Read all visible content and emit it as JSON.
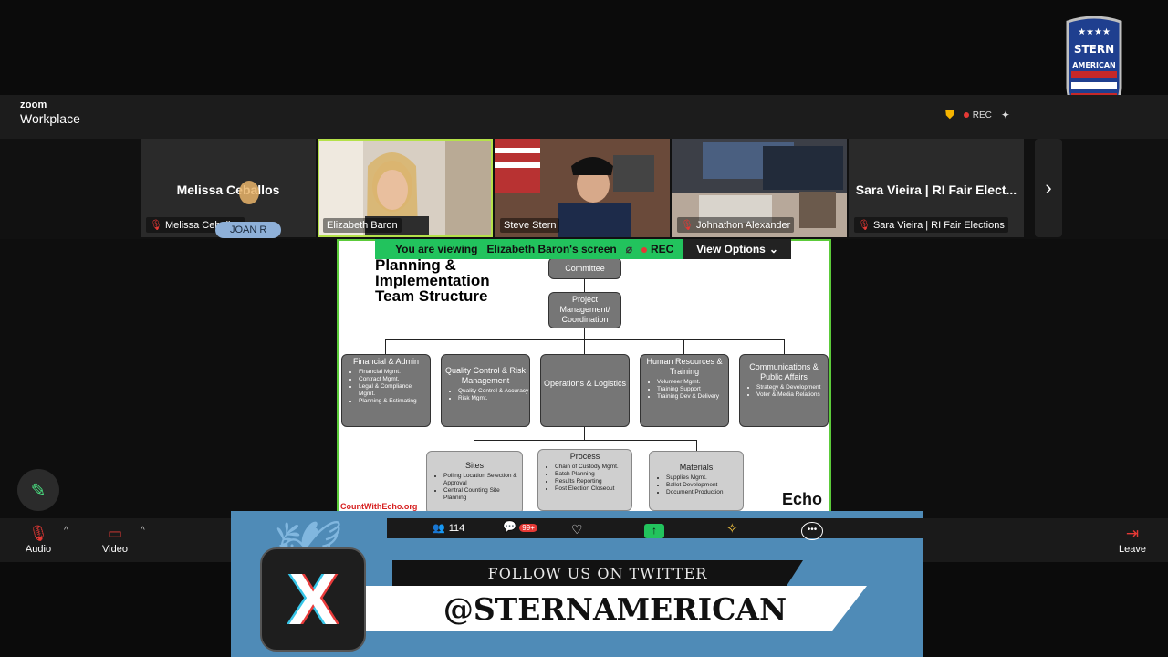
{
  "app": {
    "brand_small": "zoom",
    "brand_big": "Workplace",
    "rec_label": "REC"
  },
  "logo": {
    "text": "STERN AMERICAN"
  },
  "participants": [
    {
      "name_big": "Melissa Ceballos",
      "label": "Melissa Ceballos",
      "muted": true
    },
    {
      "label": "Elizabeth Baron",
      "muted": false,
      "active": true
    },
    {
      "label": "Steve Stern",
      "muted": false
    },
    {
      "label": "Johnathon Alexander",
      "muted": true
    },
    {
      "name_big": "Sara Vieira | RI Fair Elect...",
      "label": "Sara Vieira | RI Fair Elections",
      "muted": true
    }
  ],
  "joan_badge": "JOAN R",
  "share": {
    "viewing_prefix": "You are viewing",
    "viewing_name": "Elizabeth Baron's screen",
    "rec": "REC",
    "view_options": "View Options"
  },
  "slide": {
    "title_lines": [
      "Planning &",
      "Implementation",
      "Team Structure"
    ],
    "committee": "Committee",
    "pm": "Project Management/ Coordination",
    "departments": [
      {
        "title": "Financial & Admin",
        "items": [
          "Financial Mgmt.",
          "Contract Mgmt.",
          "Legal & Compliance Mgmt.",
          "Planning & Estimating"
        ]
      },
      {
        "title": "Quality Control & Risk Management",
        "items": [
          "Quality Control & Accuracy",
          "Risk Mgmt."
        ]
      },
      {
        "title": "Operations & Logistics",
        "items": []
      },
      {
        "title": "Human Resources & Training",
        "items": [
          "Volunteer Mgmt.",
          "Training Support",
          "Training Dev & Delivery"
        ]
      },
      {
        "title": "Communications & Public Affairs",
        "items": [
          "Strategy & Development",
          "Voter & Media Relations"
        ]
      }
    ],
    "subgroups": [
      {
        "title": "Sites",
        "items": [
          "Polling Location Selection & Approval",
          "Central Counting Site Planning"
        ]
      },
      {
        "title": "Process",
        "items": [
          "Chain of Custody Mgmt.",
          "Batch Planning",
          "Results Reporting",
          "Post Election Closeout"
        ]
      },
      {
        "title": "Materials",
        "items": [
          "Supplies Mgmt.",
          "Ballot Development",
          "Document Production"
        ]
      }
    ],
    "website": "CountWithEcho.org",
    "echo": "Echo"
  },
  "toolbar": {
    "audio": "Audio",
    "video": "Video",
    "participants_count": "114",
    "chat_badge": "99+",
    "leave": "Leave"
  },
  "twitter": {
    "follow": "FOLLOW US ON TWITTER",
    "handle": "@STERNAMERICAN",
    "x": "X"
  }
}
